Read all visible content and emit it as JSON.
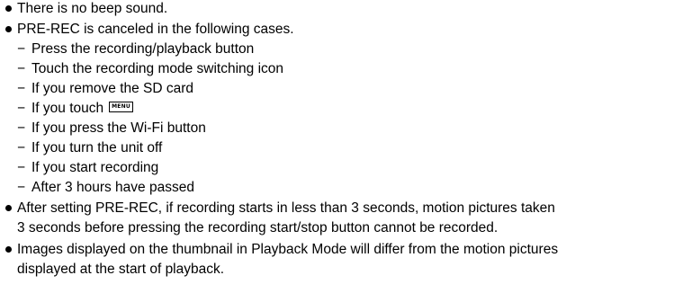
{
  "notes": {
    "bullet_1": "There is no beep sound.",
    "bullet_2": "PRE-REC is canceled in the following cases.",
    "cases": [
      "Press the recording/playback button",
      "Touch the recording mode switching icon",
      "If you remove the SD card",
      "If you touch",
      "If you press the Wi-Fi button",
      "If you turn the unit off",
      "If you start recording",
      "After 3 hours have passed"
    ],
    "menu_icon_label": "MENU",
    "dash_symbol": "−",
    "bullet_3_line_1": "After setting PRE-REC, if recording starts in less than 3 seconds, motion pictures taken",
    "bullet_3_line_2": "3 seconds before pressing the recording start/stop button cannot be recorded.",
    "bullet_4_line_1": "Images displayed on the thumbnail in Playback Mode will differ from the motion pictures",
    "bullet_4_line_2": "displayed at the start of playback."
  }
}
